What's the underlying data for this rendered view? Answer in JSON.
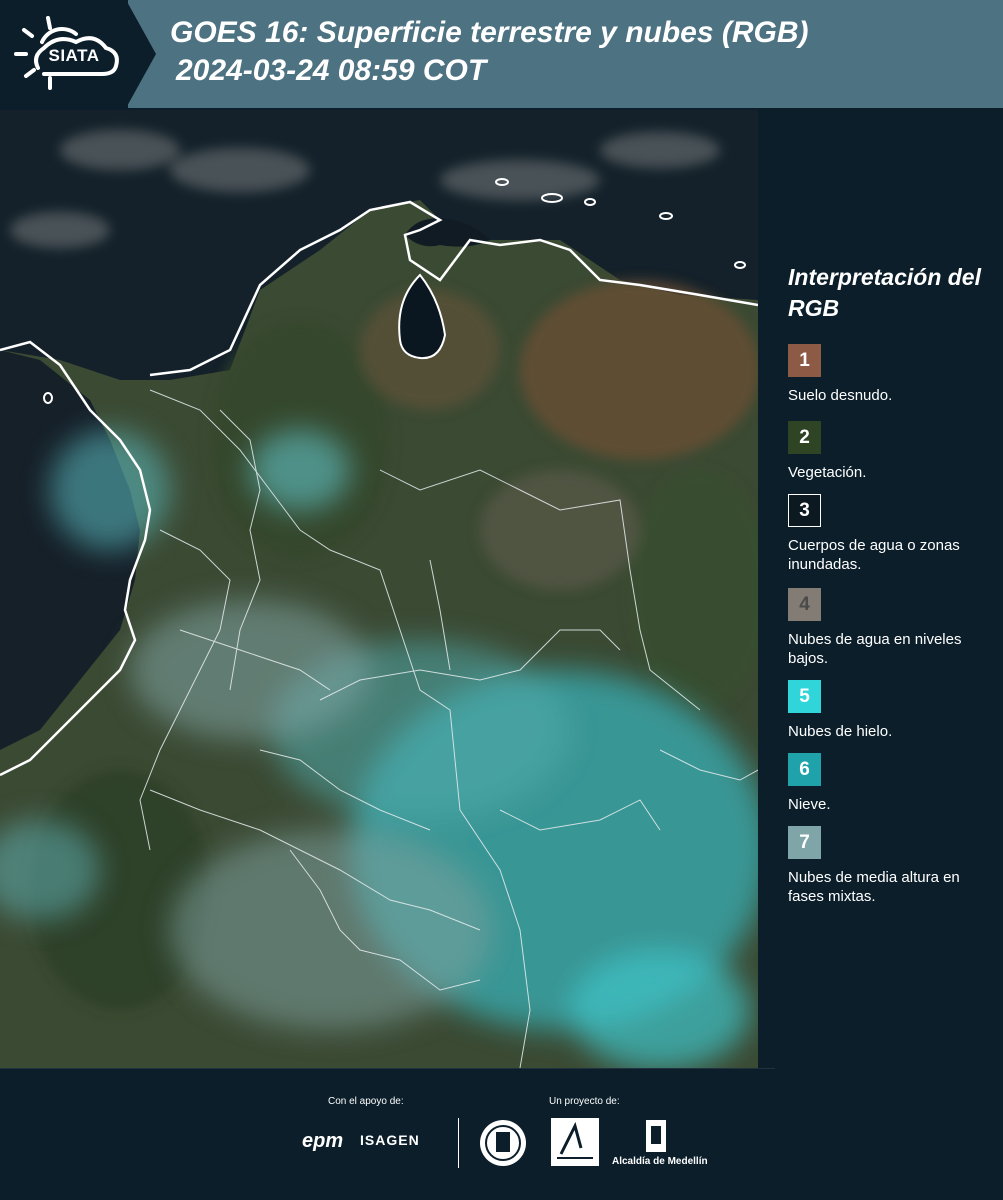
{
  "header": {
    "logo_text": "SIATA",
    "title_line1": "GOES 16: Superficie terrestre y nubes (RGB)",
    "title_line2": "2024-03-24 08:59 COT"
  },
  "legend": {
    "title": "Interpretación del RGB",
    "items": [
      {
        "number": "1",
        "label": "Suelo desnudo.",
        "color": "#8c5a45"
      },
      {
        "number": "2",
        "label": "Vegetación.",
        "color": "#2f4424"
      },
      {
        "number": "3",
        "label": "Cuerpos de agua o zonas inundadas.",
        "color": "#0d1920"
      },
      {
        "number": "4",
        "label": "Nubes de agua en niveles bajos.",
        "color": "#837c74"
      },
      {
        "number": "5",
        "label": "Nubes de hielo.",
        "color": "#2fd5d8"
      },
      {
        "number": "6",
        "label": "Nieve.",
        "color": "#20a2ab"
      },
      {
        "number": "7",
        "label": "Nubes de media altura en fases mixtas.",
        "color": "#7fa5a8"
      }
    ]
  },
  "footer": {
    "support_label": "Con el apoyo de:",
    "project_label": "Un proyecto de:",
    "sponsor_1": "epm",
    "sponsor_2": "ISAGEN",
    "partner_3": "Alcaldía de Medellín"
  },
  "colors": {
    "header_bg": "#4d7282",
    "dark_bg": "#0b1e2a"
  }
}
